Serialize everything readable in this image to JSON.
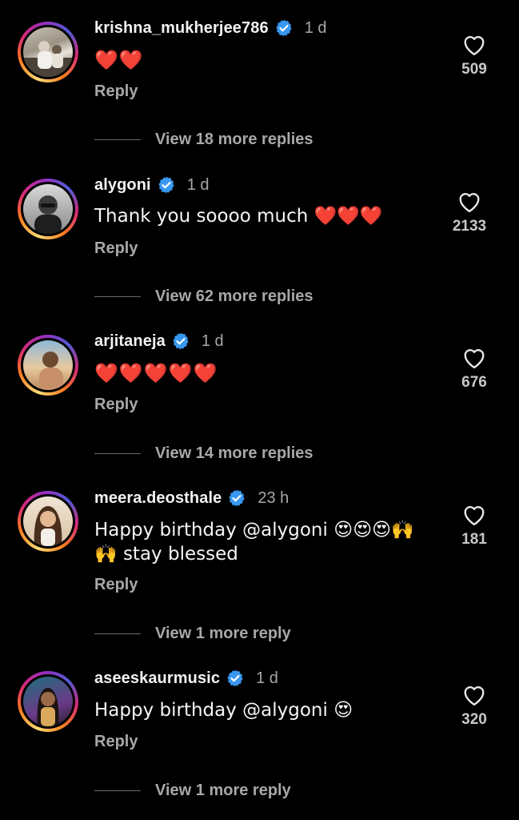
{
  "comments": [
    {
      "username": "krishna_mukherjee786",
      "time": "1 d",
      "text": "❤️❤️",
      "reply_label": "Reply",
      "likes": "509",
      "more_replies": "View 18 more replies",
      "verified": true
    },
    {
      "username": "alygoni",
      "time": "1 d",
      "text": "Thank you soooo much ❤️❤️❤️",
      "reply_label": "Reply",
      "likes": "2133",
      "more_replies": "View 62 more replies",
      "verified": true
    },
    {
      "username": "arjitaneja",
      "time": "1 d",
      "text": "❤️❤️❤️❤️❤️",
      "reply_label": "Reply",
      "likes": "676",
      "more_replies": "View 14 more replies",
      "verified": true
    },
    {
      "username": "meera.deosthale",
      "time": "23 h",
      "text": "Happy birthday @alygoni 😍😍😍🙌",
      "text_line2": "🙌 stay blessed",
      "reply_label": "Reply",
      "likes": "181",
      "more_replies": "View 1 more reply",
      "verified": true
    },
    {
      "username": "aseeskaurmusic",
      "time": "1 d",
      "text": "Happy birthday @alygoni 😍",
      "reply_label": "Reply",
      "likes": "320",
      "more_replies": "View 1 more reply",
      "verified": true
    }
  ],
  "colors": {
    "background": "#000000",
    "verified_badge": "#3897f0",
    "muted_text": "#a8a8a8",
    "heart_red": "#ff2d3a"
  },
  "icons": {
    "verified": "verified-badge-icon",
    "like": "heart-outline-icon"
  }
}
